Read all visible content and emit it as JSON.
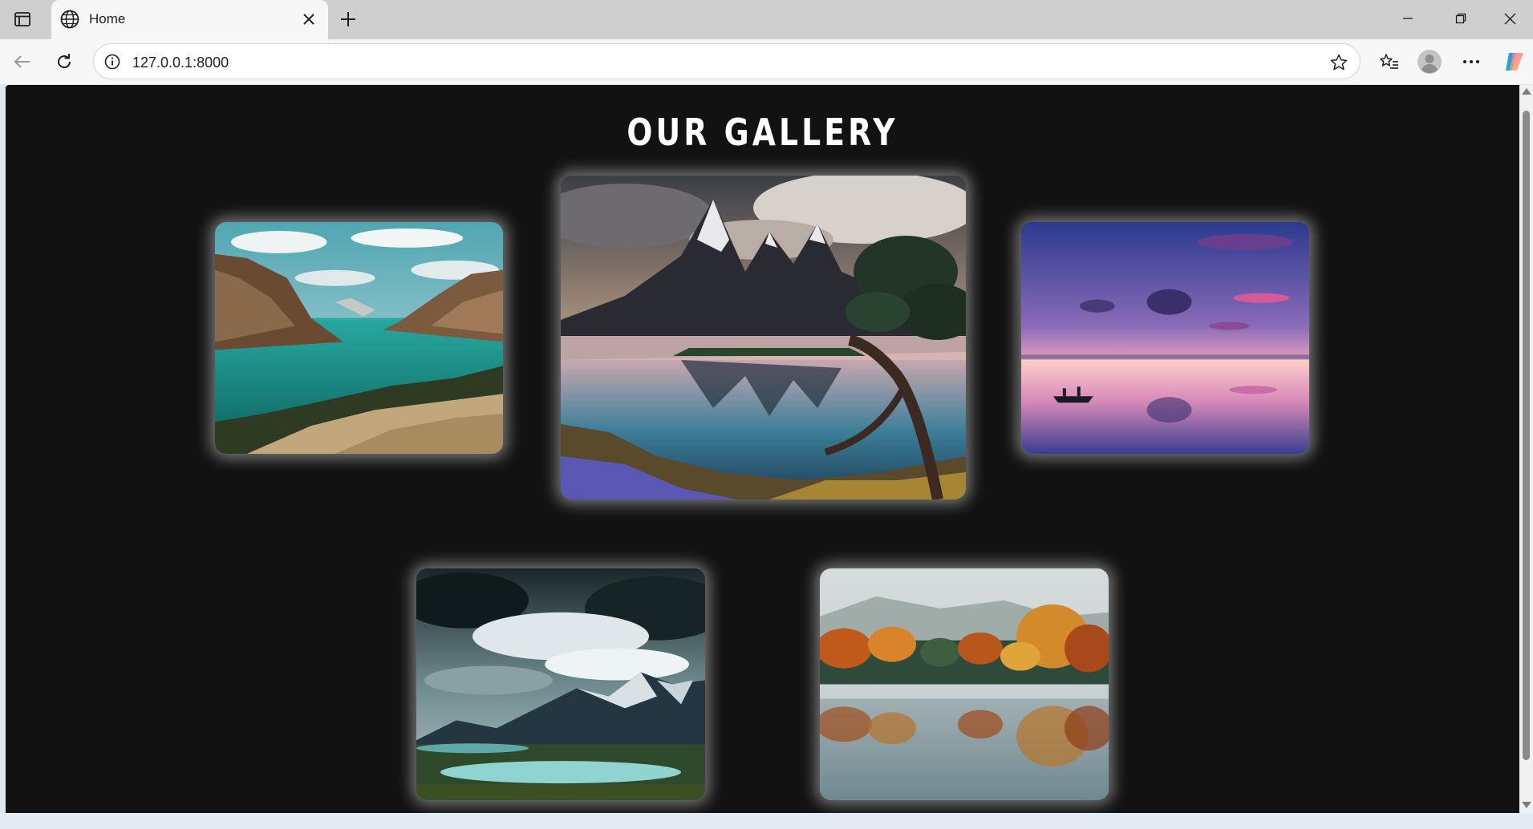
{
  "browser": {
    "tab": {
      "title": "Home"
    },
    "address_bar": {
      "url": "127.0.0.1:8000"
    }
  },
  "page": {
    "heading": "OUR GALLERY",
    "photos": [
      {
        "subject": "turquoise fjord between rocky cliffs"
      },
      {
        "subject": "jagged mountain peaks reflected in a lake with a twisted tree"
      },
      {
        "subject": "pink and purple sunset over calm water with a small boat"
      },
      {
        "subject": "stormy clouds over snowy mountains and a glacial lake"
      },
      {
        "subject": "autumn forest reflected in a misty lake"
      }
    ]
  },
  "icons": {
    "tab_actions": "tab-actions-icon",
    "globe": "globe-icon",
    "close": "close-icon",
    "new_tab": "plus-icon",
    "back": "back-arrow-icon",
    "refresh": "refresh-icon",
    "info": "info-icon",
    "favorite": "star-icon",
    "favorites": "favorites-icon",
    "profile": "profile-icon",
    "more": "more-icon",
    "copilot": "copilot-icon"
  },
  "colors": {
    "page_background": "#121212",
    "heading": "#ffffff",
    "photo_glow": "rgba(255,255,255,0.42)"
  }
}
